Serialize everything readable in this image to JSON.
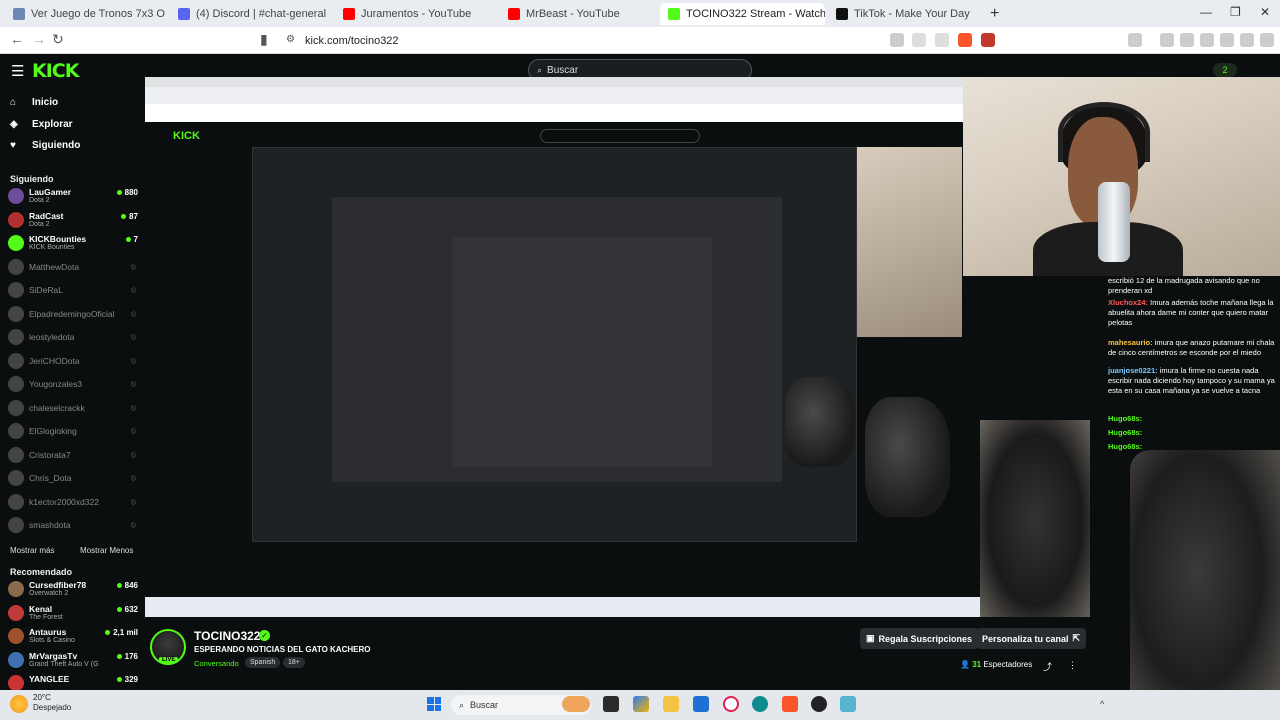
{
  "browser": {
    "tabs": [
      {
        "title": "Ver Juego de Tronos 7x3 Online Grati",
        "color": "#6d88b3",
        "active": false
      },
      {
        "title": "(4) Discord | #chat-general",
        "color": "#5865f2",
        "active": false
      },
      {
        "title": "Juramentos - YouTube",
        "color": "#ff0000",
        "active": false
      },
      {
        "title": "MrBeast - YouTube",
        "color": "#ff0000",
        "active": false
      },
      {
        "title": "TOCINO322 Stream - Watch l",
        "color": "#53fc18",
        "active": true
      },
      {
        "title": "TikTok - Make Your Day",
        "color": "#111111",
        "active": false
      }
    ],
    "url": "kick.com/tocino322"
  },
  "header": {
    "logo": "KICK",
    "search_placeholder": "Buscar",
    "badge_count": "2"
  },
  "sidebar": {
    "nav": [
      {
        "label": "Inicio",
        "icon": "home-icon",
        "glyph": "⌂"
      },
      {
        "label": "Explorar",
        "icon": "compass-icon",
        "glyph": "◈"
      },
      {
        "label": "Siguiendo",
        "icon": "heart-icon",
        "glyph": "♥"
      }
    ],
    "following_title": "Siguiendo",
    "following": [
      {
        "name": "LauGamer",
        "sub": "Dota 2",
        "viewers": "880",
        "color": "#6b4d9a",
        "live": true
      },
      {
        "name": "RadCast",
        "sub": "Dota 2",
        "viewers": "87",
        "color": "#b03030",
        "live": true
      },
      {
        "name": "KICKBounties",
        "sub": "KICK Bounties",
        "viewers": "7",
        "color": "#53fc18",
        "live": true
      },
      {
        "name": "MatthewDota",
        "sub": "",
        "viewers": "",
        "color": "#444",
        "live": false
      },
      {
        "name": "SiDeRaL",
        "sub": "",
        "viewers": "",
        "color": "#444",
        "live": false
      },
      {
        "name": "ElpadredemingoOficial",
        "sub": "",
        "viewers": "",
        "color": "#444",
        "live": false
      },
      {
        "name": "leostyledota",
        "sub": "",
        "viewers": "",
        "color": "#444",
        "live": false
      },
      {
        "name": "JeriCHODota",
        "sub": "",
        "viewers": "",
        "color": "#444",
        "live": false
      },
      {
        "name": "Yougonzales3",
        "sub": "",
        "viewers": "",
        "color": "#444",
        "live": false
      },
      {
        "name": "chaleselcrackk",
        "sub": "",
        "viewers": "",
        "color": "#444",
        "live": false
      },
      {
        "name": "ElGlogioking",
        "sub": "",
        "viewers": "",
        "color": "#444",
        "live": false
      },
      {
        "name": "Cristorata7",
        "sub": "",
        "viewers": "",
        "color": "#444",
        "live": false
      },
      {
        "name": "Chris_Dota",
        "sub": "",
        "viewers": "",
        "color": "#444",
        "live": false
      },
      {
        "name": "k1ector2000xd322",
        "sub": "",
        "viewers": "",
        "color": "#444",
        "live": false
      },
      {
        "name": "smashdota",
        "sub": "",
        "viewers": "",
        "color": "#444",
        "live": false
      }
    ],
    "show_more": "Mostrar más",
    "show_less": "Mostrar Menos",
    "recommended_title": "Recomendado",
    "recommended": [
      {
        "name": "Cursedfiber78",
        "sub": "Overwatch 2",
        "viewers": "846",
        "color": "#8a6a4a"
      },
      {
        "name": "Kenal",
        "sub": "The Forest",
        "viewers": "632",
        "color": "#c03a3a"
      },
      {
        "name": "Antaurus",
        "sub": "Slots & Casino",
        "viewers": "2,1 mil",
        "color": "#a0522d"
      },
      {
        "name": "MrVargasTv",
        "sub": "Grand Theft Auto V (G",
        "viewers": "176",
        "color": "#3f6fb0"
      },
      {
        "name": "YANGLEE",
        "sub": "",
        "viewers": "329",
        "color": "#cc3333"
      }
    ]
  },
  "chat": {
    "messages": [
      {
        "user": "",
        "text": "escribió 12 de la madrugada avisando que no prenderan xd",
        "color": "#ffffff",
        "top": 0
      },
      {
        "user": "Xluchox24:",
        "text": "Imura además toche mañana llega la abuelita ahora dame mi conter que quiero matar pelotas",
        "color": "#ff5a5a"
      },
      {
        "user": "mahesaurio:",
        "text": "imura que anazo putamare mi chala de cinco centímetros se esconde por el miedo",
        "color": "#f5c542"
      },
      {
        "user": "juanjose0221:",
        "text": "imura la firme no cuesta nada escribir nada diciendo hoy tampoco y su mama ya esta en su casa mañana ya se vuelve a tacna",
        "color": "#7ec8ff"
      },
      {
        "user": "Hugo68s:",
        "text": "",
        "color": "#53fc18"
      },
      {
        "user": "Hugo68s:",
        "text": "",
        "color": "#53fc18"
      },
      {
        "user": "Hugo68s:",
        "text": "",
        "color": "#53fc18"
      }
    ]
  },
  "stream": {
    "streamer": "TOCINO322",
    "live_label": "LIVE",
    "title": "ESPERANDO NOTICIAS DEL GATO KACHERO",
    "category": "Conversando",
    "tags": [
      "Spanish",
      "18+"
    ],
    "gift_label": "Regala Suscripciones",
    "customize_label": "Personaliza tu canal",
    "viewers_count": "31",
    "viewers_label": "Espectadores"
  },
  "taskbar": {
    "temp": "20°C",
    "weather": "Despejado",
    "search": "Buscar"
  }
}
